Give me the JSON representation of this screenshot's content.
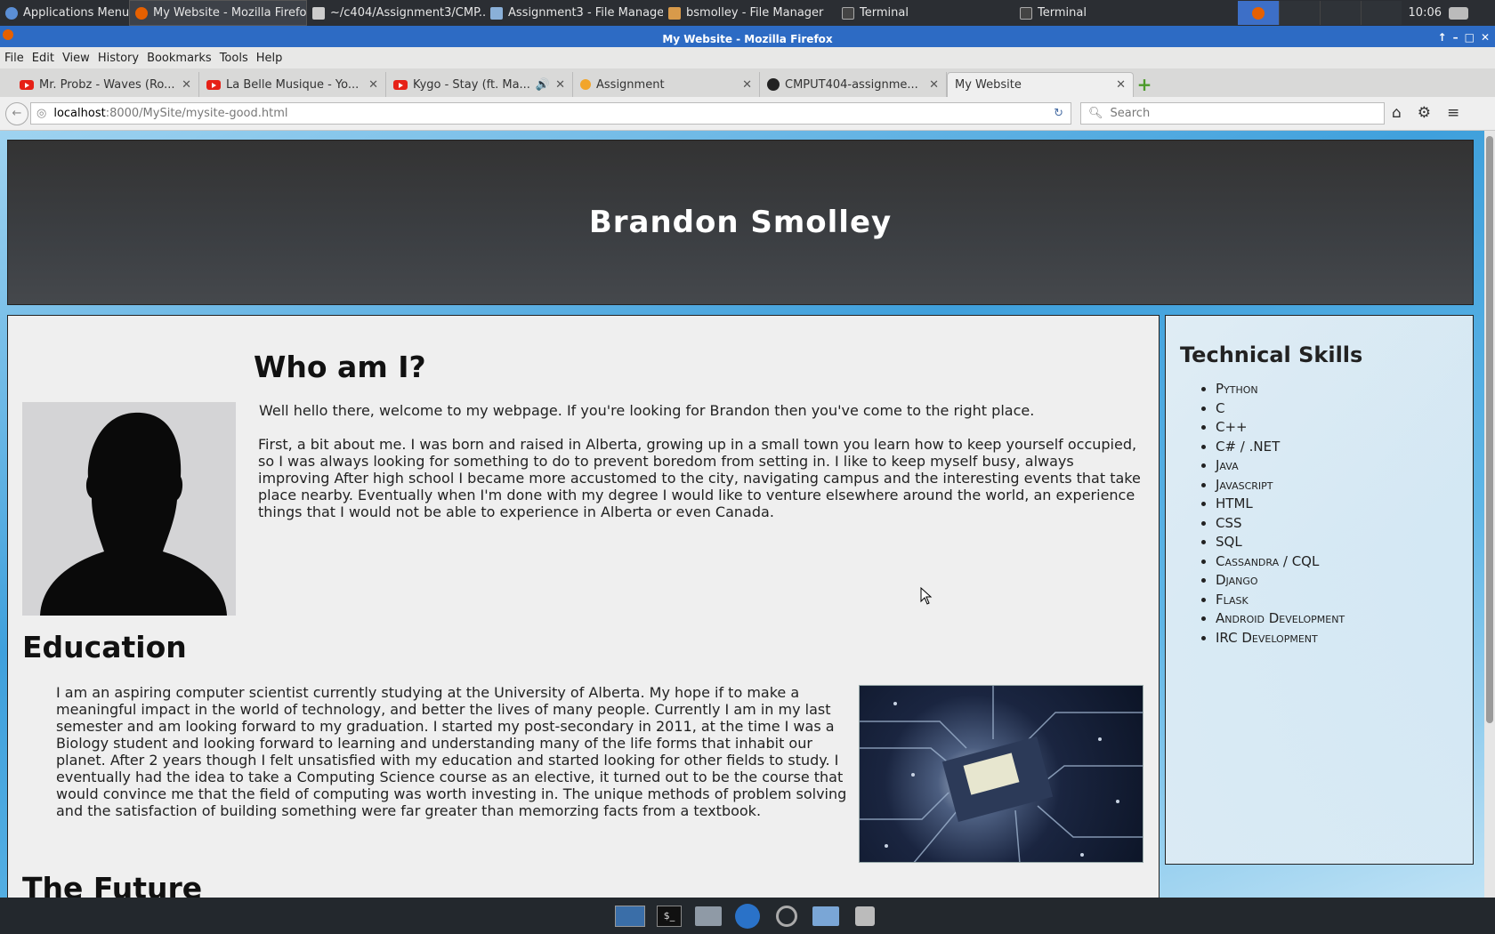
{
  "panel": {
    "apps_menu": "Applications Menu",
    "tasks": [
      {
        "label": "My Website - Mozilla Firefox"
      },
      {
        "label": "~/c404/Assignment3/CMP..."
      },
      {
        "label": "Assignment3 - File Manager"
      },
      {
        "label": "bsmolley - File Manager"
      },
      {
        "label": "Terminal"
      },
      {
        "label": "Terminal"
      }
    ],
    "clock": "10:06"
  },
  "window": {
    "title": "My Website - Mozilla Firefox",
    "menu": [
      "File",
      "Edit",
      "View",
      "History",
      "Bookmarks",
      "Tools",
      "Help"
    ],
    "tabs": [
      {
        "label": "Mr. Probz - Waves (Ro..."
      },
      {
        "label": "La Belle Musique - Yo..."
      },
      {
        "label": "Kygo - Stay (ft. Ma..."
      },
      {
        "label": "Assignment"
      },
      {
        "label": "CMPUT404-assignme..."
      },
      {
        "label": "My Website"
      }
    ],
    "url": {
      "host": "localhost",
      "path": ":8000/MySite/mysite-good.html"
    },
    "search_placeholder": "Search"
  },
  "site": {
    "name": "Brandon Smolley",
    "who": {
      "title": "Who am I?",
      "p1": "Well hello there, welcome to my webpage. If you're looking for Brandon then you've come to the right place.",
      "p2": "First, a bit about me. I was born and raised in Alberta, growing up in a small town you learn how to keep yourself occupied, so I was always looking for something to do to prevent boredom from setting in. I like to keep myself busy, always improving After high school I became more accustomed to the city, navigating campus and the interesting events that take place nearby. Eventually when I'm done with my degree I would like to venture elsewhere around the world, an experience things that I would not be able to experience in Alberta or even Canada."
    },
    "education": {
      "title": "Education",
      "p": "I am an aspiring computer scientist currently studying at the University of Alberta. My hope if to make a meaningful impact in the world of technology, and better the lives of many people. Currently I am in my last semester and am looking forward to my graduation. I started my post-secondary in 2011, at the time I was a Biology student and looking forward to learning and understanding many of the life forms that inhabit our planet. After 2 years though I felt unsatisfied with my education and started looking for other fields to study. I eventually had the idea to take a Computing Science course as an elective, it turned out to be the course that would convince me that the field of computing was worth investing in. The unique methods of problem solving and the satisfaction of building something were far greater than memorzing facts from a textbook."
    },
    "future": {
      "title": "The Future"
    },
    "skills": {
      "title": "Technical Skills",
      "items": [
        "Python",
        "C",
        "C++",
        "C# / .NET",
        "Java",
        "Javascript",
        "HTML",
        "CSS",
        "SQL",
        "Cassandra / CQL",
        "Django",
        "Flask",
        "Android Development",
        "IRC Development"
      ]
    }
  }
}
